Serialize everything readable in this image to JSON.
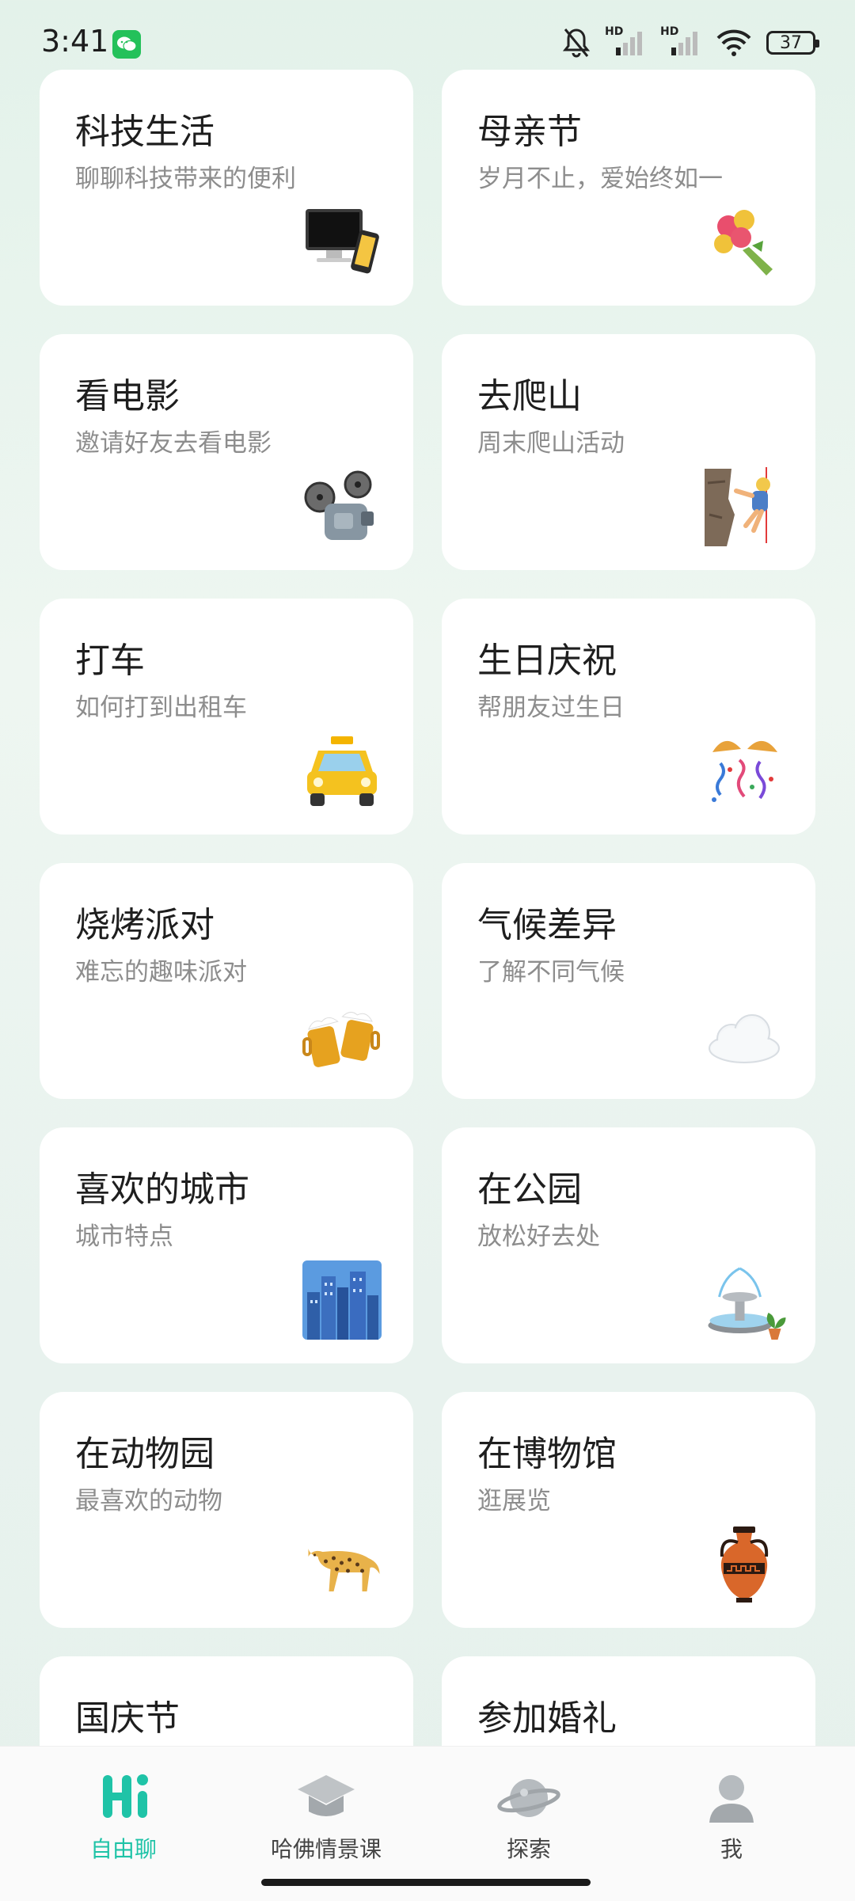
{
  "status_bar": {
    "time": "3:41",
    "icons": [
      "wechat-icon",
      "mute-bell-icon",
      "hd-signal-icon",
      "hd-signal-icon",
      "wifi-icon",
      "battery-icon"
    ],
    "hd1": "HD",
    "hd2": "HD",
    "battery": "37"
  },
  "cards": [
    {
      "title": "科技生活",
      "subtitle": "聊聊科技带来的便利",
      "icon": "computer-phone-icon"
    },
    {
      "title": "母亲节",
      "subtitle": "岁月不止，爱始终如一",
      "icon": "bouquet-icon"
    },
    {
      "title": "看电影",
      "subtitle": "邀请好友去看电影",
      "icon": "film-projector-icon"
    },
    {
      "title": "去爬山",
      "subtitle": "周末爬山活动",
      "icon": "climber-icon"
    },
    {
      "title": "打车",
      "subtitle": "如何打到出租车",
      "icon": "taxi-icon"
    },
    {
      "title": "生日庆祝",
      "subtitle": "帮朋友过生日",
      "icon": "confetti-icon"
    },
    {
      "title": "烧烤派对",
      "subtitle": "难忘的趣味派对",
      "icon": "beer-mugs-icon"
    },
    {
      "title": "气候差异",
      "subtitle": "了解不同气候",
      "icon": "cloud-icon"
    },
    {
      "title": "喜欢的城市",
      "subtitle": "城市特点",
      "icon": "cityscape-icon"
    },
    {
      "title": "在公园",
      "subtitle": "放松好去处",
      "icon": "fountain-icon"
    },
    {
      "title": "在动物园",
      "subtitle": "最喜欢的动物",
      "icon": "leopard-icon"
    },
    {
      "title": "在博物馆",
      "subtitle": "逛展览",
      "icon": "amphora-icon"
    },
    {
      "title": "国庆节",
      "subtitle": "",
      "icon": ""
    },
    {
      "title": "参加婚礼",
      "subtitle": "",
      "icon": ""
    }
  ],
  "tabs": [
    {
      "label": "自由聊",
      "icon": "hi-icon",
      "active": true
    },
    {
      "label": "哈佛情景课",
      "icon": "graduation-cap-icon",
      "active": false
    },
    {
      "label": "探索",
      "icon": "planet-icon",
      "active": false
    },
    {
      "label": "我",
      "icon": "person-icon",
      "active": false
    }
  ],
  "colors": {
    "accent": "#1fc3a7",
    "card": "#ffffff",
    "background": "#e6f1ec"
  }
}
